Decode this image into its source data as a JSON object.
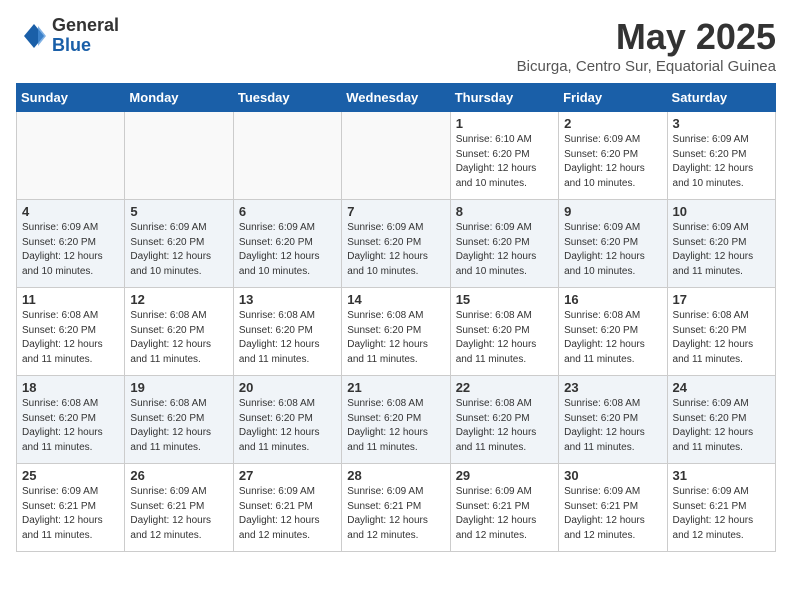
{
  "logo": {
    "general": "General",
    "blue": "Blue"
  },
  "title": "May 2025",
  "subtitle": "Bicurga, Centro Sur, Equatorial Guinea",
  "days_of_week": [
    "Sunday",
    "Monday",
    "Tuesday",
    "Wednesday",
    "Thursday",
    "Friday",
    "Saturday"
  ],
  "weeks": [
    [
      {
        "day": "",
        "info": ""
      },
      {
        "day": "",
        "info": ""
      },
      {
        "day": "",
        "info": ""
      },
      {
        "day": "",
        "info": ""
      },
      {
        "day": "1",
        "info": "Sunrise: 6:10 AM\nSunset: 6:20 PM\nDaylight: 12 hours\nand 10 minutes."
      },
      {
        "day": "2",
        "info": "Sunrise: 6:09 AM\nSunset: 6:20 PM\nDaylight: 12 hours\nand 10 minutes."
      },
      {
        "day": "3",
        "info": "Sunrise: 6:09 AM\nSunset: 6:20 PM\nDaylight: 12 hours\nand 10 minutes."
      }
    ],
    [
      {
        "day": "4",
        "info": "Sunrise: 6:09 AM\nSunset: 6:20 PM\nDaylight: 12 hours\nand 10 minutes."
      },
      {
        "day": "5",
        "info": "Sunrise: 6:09 AM\nSunset: 6:20 PM\nDaylight: 12 hours\nand 10 minutes."
      },
      {
        "day": "6",
        "info": "Sunrise: 6:09 AM\nSunset: 6:20 PM\nDaylight: 12 hours\nand 10 minutes."
      },
      {
        "day": "7",
        "info": "Sunrise: 6:09 AM\nSunset: 6:20 PM\nDaylight: 12 hours\nand 10 minutes."
      },
      {
        "day": "8",
        "info": "Sunrise: 6:09 AM\nSunset: 6:20 PM\nDaylight: 12 hours\nand 10 minutes."
      },
      {
        "day": "9",
        "info": "Sunrise: 6:09 AM\nSunset: 6:20 PM\nDaylight: 12 hours\nand 10 minutes."
      },
      {
        "day": "10",
        "info": "Sunrise: 6:09 AM\nSunset: 6:20 PM\nDaylight: 12 hours\nand 11 minutes."
      }
    ],
    [
      {
        "day": "11",
        "info": "Sunrise: 6:08 AM\nSunset: 6:20 PM\nDaylight: 12 hours\nand 11 minutes."
      },
      {
        "day": "12",
        "info": "Sunrise: 6:08 AM\nSunset: 6:20 PM\nDaylight: 12 hours\nand 11 minutes."
      },
      {
        "day": "13",
        "info": "Sunrise: 6:08 AM\nSunset: 6:20 PM\nDaylight: 12 hours\nand 11 minutes."
      },
      {
        "day": "14",
        "info": "Sunrise: 6:08 AM\nSunset: 6:20 PM\nDaylight: 12 hours\nand 11 minutes."
      },
      {
        "day": "15",
        "info": "Sunrise: 6:08 AM\nSunset: 6:20 PM\nDaylight: 12 hours\nand 11 minutes."
      },
      {
        "day": "16",
        "info": "Sunrise: 6:08 AM\nSunset: 6:20 PM\nDaylight: 12 hours\nand 11 minutes."
      },
      {
        "day": "17",
        "info": "Sunrise: 6:08 AM\nSunset: 6:20 PM\nDaylight: 12 hours\nand 11 minutes."
      }
    ],
    [
      {
        "day": "18",
        "info": "Sunrise: 6:08 AM\nSunset: 6:20 PM\nDaylight: 12 hours\nand 11 minutes."
      },
      {
        "day": "19",
        "info": "Sunrise: 6:08 AM\nSunset: 6:20 PM\nDaylight: 12 hours\nand 11 minutes."
      },
      {
        "day": "20",
        "info": "Sunrise: 6:08 AM\nSunset: 6:20 PM\nDaylight: 12 hours\nand 11 minutes."
      },
      {
        "day": "21",
        "info": "Sunrise: 6:08 AM\nSunset: 6:20 PM\nDaylight: 12 hours\nand 11 minutes."
      },
      {
        "day": "22",
        "info": "Sunrise: 6:08 AM\nSunset: 6:20 PM\nDaylight: 12 hours\nand 11 minutes."
      },
      {
        "day": "23",
        "info": "Sunrise: 6:08 AM\nSunset: 6:20 PM\nDaylight: 12 hours\nand 11 minutes."
      },
      {
        "day": "24",
        "info": "Sunrise: 6:09 AM\nSunset: 6:20 PM\nDaylight: 12 hours\nand 11 minutes."
      }
    ],
    [
      {
        "day": "25",
        "info": "Sunrise: 6:09 AM\nSunset: 6:21 PM\nDaylight: 12 hours\nand 11 minutes."
      },
      {
        "day": "26",
        "info": "Sunrise: 6:09 AM\nSunset: 6:21 PM\nDaylight: 12 hours\nand 12 minutes."
      },
      {
        "day": "27",
        "info": "Sunrise: 6:09 AM\nSunset: 6:21 PM\nDaylight: 12 hours\nand 12 minutes."
      },
      {
        "day": "28",
        "info": "Sunrise: 6:09 AM\nSunset: 6:21 PM\nDaylight: 12 hours\nand 12 minutes."
      },
      {
        "day": "29",
        "info": "Sunrise: 6:09 AM\nSunset: 6:21 PM\nDaylight: 12 hours\nand 12 minutes."
      },
      {
        "day": "30",
        "info": "Sunrise: 6:09 AM\nSunset: 6:21 PM\nDaylight: 12 hours\nand 12 minutes."
      },
      {
        "day": "31",
        "info": "Sunrise: 6:09 AM\nSunset: 6:21 PM\nDaylight: 12 hours\nand 12 minutes."
      }
    ]
  ]
}
